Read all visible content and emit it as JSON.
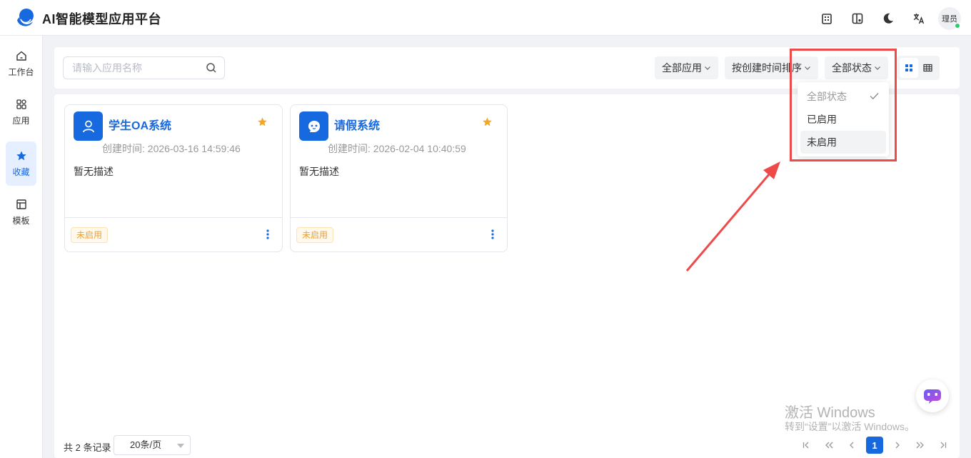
{
  "header": {
    "title": "AI智能模型应用平台",
    "avatar_text": "理员"
  },
  "sidebar": {
    "items": [
      {
        "label": "工作台",
        "icon": "home-icon"
      },
      {
        "label": "应用",
        "icon": "apps-icon"
      },
      {
        "label": "收藏",
        "icon": "star-icon",
        "active": true
      },
      {
        "label": "模板",
        "icon": "template-icon"
      }
    ]
  },
  "toolbar": {
    "search_placeholder": "请输入应用名称",
    "filter_app": "全部应用",
    "filter_sort": "按创建时间排序",
    "filter_status": "全部状态"
  },
  "dropdown": {
    "items": [
      "全部状态",
      "已启用",
      "未启用"
    ],
    "selected": "全部状态",
    "hovered": "未启用"
  },
  "cards": [
    {
      "title": "学生OA系统",
      "time": "创建时间: 2026-03-16 14:59:46",
      "desc": "暂无描述",
      "status": "未启用",
      "icon": "user-icon"
    },
    {
      "title": "请假系统",
      "time": "创建时间: 2026-02-04 10:40:59",
      "desc": "暂无描述",
      "status": "未启用",
      "icon": "bot-face-icon"
    }
  ],
  "pagination": {
    "total": "共 2 条记录",
    "page_size": "20条/页",
    "current": "1"
  },
  "watermark": {
    "line1": "激活 Windows",
    "line2": "转到“设置”以激活 Windows。"
  },
  "colors": {
    "primary": "#1769e0",
    "highlight": "#ef4a4a",
    "warning": "#e6a23c"
  }
}
